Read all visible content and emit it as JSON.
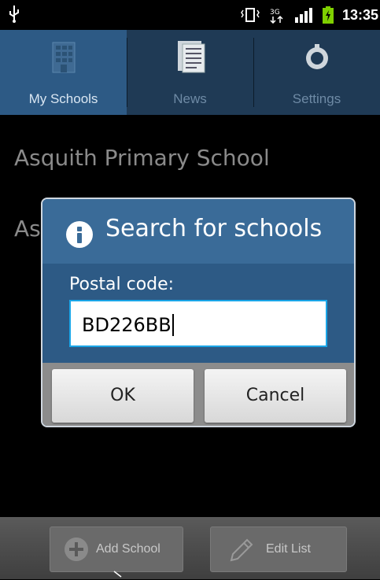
{
  "status_bar": {
    "time": "13:35",
    "network": "3G"
  },
  "tabs": [
    {
      "label": "My Schools",
      "icon": "building-icon",
      "active": true
    },
    {
      "label": "News",
      "icon": "news-icon",
      "active": false
    },
    {
      "label": "Settings",
      "icon": "settings-icon",
      "active": false
    }
  ],
  "list": [
    {
      "name": "Asquith Primary School"
    },
    {
      "name": "As"
    }
  ],
  "dialog": {
    "title": "Search for schools",
    "label": "Postal code:",
    "input_value": "BD226BB",
    "ok_label": "OK",
    "cancel_label": "Cancel"
  },
  "bottom_bar": {
    "add_label": "Add School",
    "edit_label": "Edit List"
  },
  "colors": {
    "accent": "#2d5a85",
    "focus": "#1aa6e8"
  }
}
